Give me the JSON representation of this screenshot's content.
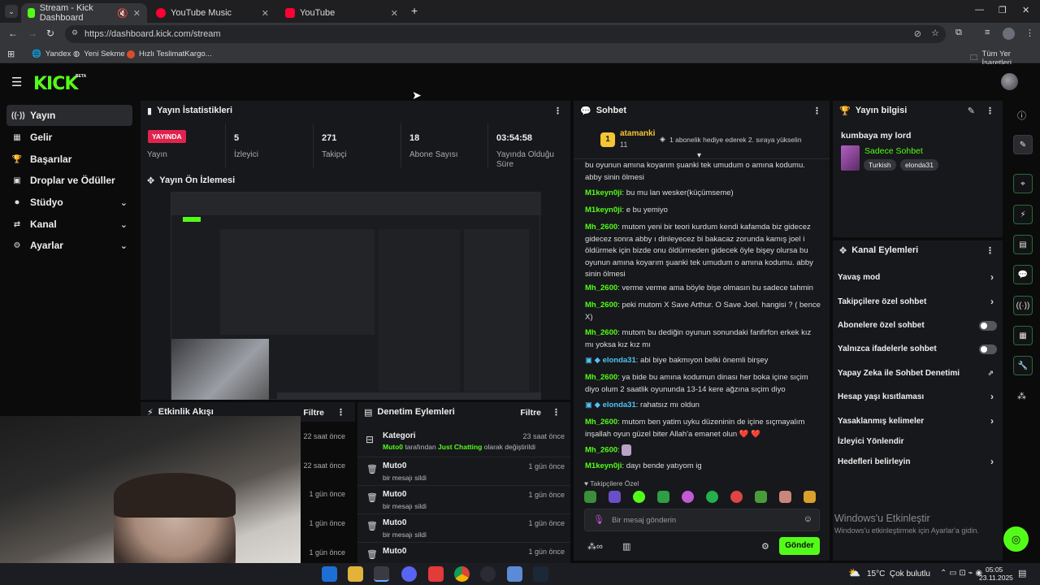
{
  "browser": {
    "tabs": [
      {
        "label": "Stream - Kick Dashboard"
      },
      {
        "label": "YouTube Music"
      },
      {
        "label": "YouTube"
      }
    ],
    "url": "https://dashboard.kick.com/stream",
    "bookmarks": [
      {
        "label": "Yandex"
      },
      {
        "label": "Yeni Sekme"
      },
      {
        "label": "Hızlı TeslimatKargo..."
      }
    ],
    "all_bookmarks": "Tüm Yer İşaretleri"
  },
  "brand": {
    "logo": "KICK",
    "beta": "BETA",
    "accent": "#53fc18"
  },
  "sidebar": {
    "items": [
      {
        "label": "Yayın",
        "icon": "broadcast-icon"
      },
      {
        "label": "Gelir",
        "icon": "revenue-icon"
      },
      {
        "label": "Başarılar",
        "icon": "trophy-icon"
      },
      {
        "label": "Droplar ve Ödüller",
        "icon": "gift-icon"
      },
      {
        "label": "Stüdyo",
        "icon": "video-icon"
      },
      {
        "label": "Kanal",
        "icon": "channel-icon"
      },
      {
        "label": "Ayarlar",
        "icon": "gear-icon"
      }
    ]
  },
  "stats": {
    "title": "Yayın İstatistikleri",
    "live_label": "YAYINDA",
    "items": [
      {
        "value": "",
        "label": "Yayın"
      },
      {
        "value": "5",
        "label": "İzleyici"
      },
      {
        "value": "271",
        "label": "Takipçi"
      },
      {
        "value": "18",
        "label": "Abone Sayısı"
      },
      {
        "value": "03:54:58",
        "label": "Yayında Olduğu Süre"
      }
    ]
  },
  "preview": {
    "title": "Yayın Ön İzlemesi"
  },
  "activity": {
    "title": "Etkinlik Akışı",
    "filter": "Filtre",
    "times": [
      "22 saat önce",
      "22 saat önce",
      "1 gün önce",
      "1 gün önce",
      "1 gün önce"
    ]
  },
  "moderation": {
    "title": "Denetim Eylemleri",
    "filter": "Filtre",
    "items": [
      {
        "title": "Kategori",
        "user": "Muto0",
        "middle": " tarafından ",
        "target": "Just Chatting",
        "tail": " olarak değiştirildi",
        "time": "23 saat önce"
      },
      {
        "title": "Muto0",
        "sub": "bir mesajı sildi",
        "time": "1 gün önce"
      },
      {
        "title": "Muto0",
        "sub": "bir mesajı sildi",
        "time": "1 gün önce"
      },
      {
        "title": "Muto0",
        "sub": "bir mesajı sildi",
        "time": "1 gün önce"
      },
      {
        "title": "Muto0",
        "sub": "",
        "time": "1 gün önce"
      }
    ]
  },
  "chat": {
    "title": "Sohbet",
    "pinned": {
      "user": "atamanki",
      "count": "11",
      "rank": "1",
      "text": "1 abonelik hediye ederek 2. sıraya yükselin"
    },
    "messages": [
      {
        "user": "",
        "text": "bu oyunun amına koyarım şuanki tek umudum o amına kodumu. abby sinin ölmesi",
        "color": "#dddddd"
      },
      {
        "user": "M1keyn0ji",
        "text": "bu mu lan wesker(küçümseme)",
        "color": "#53fc18"
      },
      {
        "user": "M1keyn0ji",
        "text": "e bu yemiyo",
        "color": "#53fc18"
      },
      {
        "user": "Mh_2600",
        "text": "mutom yeni bir teori kurdum kendi kafamda biz gidecez gidecez sonra abby ı dinleyecez bi bakacaz zorunda kamış joel i öldürmek için bizde onu öldürmeden gidecek öyle bişey olursa bu oyunun amına koyarım şuanki tek umudum o amına kodumu. abby sinin ölmesi",
        "color": "#53fc18"
      },
      {
        "user": "Mh_2600",
        "text": "verme verme ama böyle bişe olmasın bu sadece tahmin",
        "color": "#53fc18"
      },
      {
        "user": "Mh_2600",
        "text": "peki mutom X Save Arthur. O Save Joel. hangisi ? ( bence X)",
        "color": "#53fc18"
      },
      {
        "user": "Mh_2600",
        "text": "mutom bu dediğin oyunun sonundaki fanfirfon erkek kız mı yoksa kız kız mı",
        "color": "#53fc18"
      },
      {
        "user": "elonda31",
        "text": "abi biye bakmıyon belki önemli birşey",
        "color": "#4fc3f7"
      },
      {
        "user": "Mh_2600",
        "text": "ya bide bu amına kodumun dinası her boka içine sıçim diyo olum 2 saatlik oyununda 13-14 kere ağzına sıçim diyo",
        "color": "#53fc18"
      },
      {
        "user": "elonda31",
        "text": "rahatsız mı oldun",
        "color": "#4fc3f7"
      },
      {
        "user": "Mh_2600",
        "text": "mutom ben yatim uyku düzeninin de içine sıçmayalım inşallah oyun güzel biter Allah'a emanet olun ❤️ ❤️",
        "color": "#53fc18"
      },
      {
        "user": "Mh_2600",
        "text": "",
        "color": "#53fc18"
      },
      {
        "user": "M1keyn0ji",
        "text": "dayı bende yatıyom ig",
        "color": "#53fc18"
      }
    ],
    "emote_label": "Takipçilere Özel",
    "input_placeholder": "Bir mesaj gönderin",
    "send": "Gönder"
  },
  "stream_info": {
    "title": "Yayın bilgisi",
    "stream_title": "kumbaya my lord",
    "category": "Sadece Sohbet",
    "tags": [
      "Turkish",
      "elonda31"
    ]
  },
  "channel_actions": {
    "title": "Kanal Eylemleri",
    "items": [
      {
        "label": "Yavaş mod",
        "control": "chevron"
      },
      {
        "label": "Takipçilere özel sohbet",
        "control": "chevron"
      },
      {
        "label": "Abonelere özel sohbet",
        "control": "toggle",
        "on": false
      },
      {
        "label": "Yalnızca ifadelerle sohbet",
        "control": "toggle",
        "on": false
      },
      {
        "label": "Yapay Zeka ile Sohbet Denetimi",
        "control": "external"
      },
      {
        "label": "Hesap yaşı kısıtlaması",
        "control": "chevron"
      },
      {
        "label": "Yasaklanmış kelimeler",
        "control": "chevron"
      },
      {
        "label": "İzleyici Yönlendir",
        "control": "none"
      },
      {
        "label": "Hedefleri belirleyin",
        "control": "chevron"
      }
    ]
  },
  "windows": {
    "activate_title": "Windows'u Etkinleştir",
    "activate_sub": "Windows'u etkinleştirmek için Ayarlar'a gidin.",
    "weather": "15°C  Çok bulutlu",
    "time": "05:05",
    "date": "23.11.2025"
  }
}
